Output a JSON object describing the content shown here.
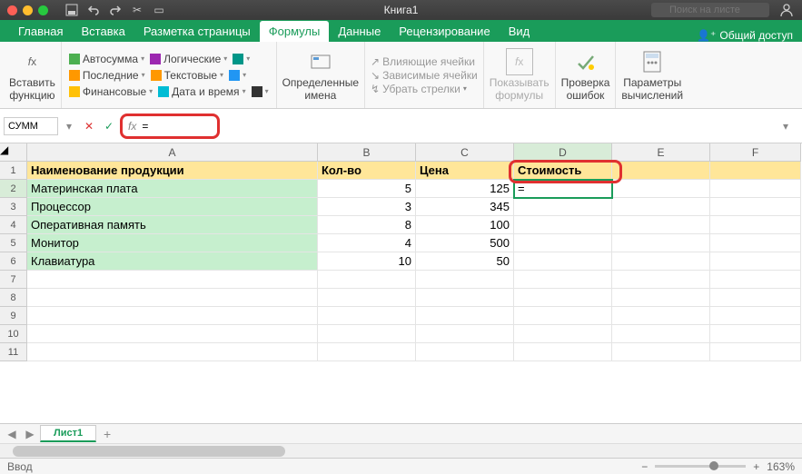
{
  "window": {
    "title": "Книга1",
    "search_placeholder": "Поиск на листе"
  },
  "tabs": {
    "home": "Главная",
    "insert": "Вставка",
    "layout": "Разметка страницы",
    "formulas": "Формулы",
    "data": "Данные",
    "review": "Рецензирование",
    "view": "Вид",
    "share": "Общий доступ"
  },
  "ribbon": {
    "insert_fn": "Вставить\nфункцию",
    "lib": {
      "autosum": "Автосумма",
      "recent": "Последние",
      "financial": "Финансовые",
      "logical": "Логические",
      "text": "Текстовые",
      "date": "Дата и время"
    },
    "defined_names": "Определенные\nимена",
    "trace": {
      "prec": "Влияющие ячейки",
      "dep": "Зависимые ячейки",
      "remove": "Убрать стрелки"
    },
    "show_formulas": "Показывать\nформулы",
    "error_check": "Проверка\nошибок",
    "calc_options": "Параметры\nвычислений"
  },
  "formula_bar": {
    "name": "СУММ",
    "value": "="
  },
  "columns": [
    "A",
    "B",
    "C",
    "D",
    "E",
    "F"
  ],
  "headers": {
    "A": "Наименование продукции",
    "B": "Кол-во",
    "C": "Цена",
    "D": "Стоимость"
  },
  "rows": [
    {
      "n": "2",
      "A": "Материнская плата",
      "B": "5",
      "C": "125"
    },
    {
      "n": "3",
      "A": "Процессор",
      "B": "3",
      "C": "345"
    },
    {
      "n": "4",
      "A": "Оперативная память",
      "B": "8",
      "C": "100"
    },
    {
      "n": "5",
      "A": "Монитор",
      "B": "4",
      "C": "500"
    },
    {
      "n": "6",
      "A": "Клавиатура",
      "B": "10",
      "C": "50"
    }
  ],
  "empty_rows": [
    "7",
    "8",
    "9",
    "10",
    "11"
  ],
  "active_cell_value": "=",
  "sheet_tab": "Лист1",
  "status": "Ввод",
  "zoom": "163%"
}
